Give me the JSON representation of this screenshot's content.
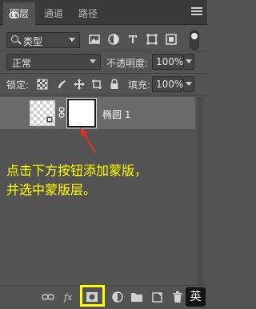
{
  "tabs": [
    {
      "label": "图层"
    },
    {
      "label": "通道"
    },
    {
      "label": "路径"
    }
  ],
  "filter": {
    "label": "类型"
  },
  "blend_mode": {
    "value": "正常"
  },
  "opacity": {
    "label": "不透明度:",
    "value": "100%"
  },
  "lock": {
    "label": "锁定:"
  },
  "fill": {
    "label": "填充:",
    "value": "100%"
  },
  "layer": {
    "name": "椭圆 1"
  },
  "instruction": {
    "line1": "点击下方按钮添加蒙版，",
    "line2": "并选中蒙版层。"
  },
  "ime": {
    "label": "英"
  },
  "colors": {
    "annotation": "#ffff00",
    "arrow": "#e0302a",
    "panel_bg": "#535353",
    "layer_selected": "#6a6a6a"
  }
}
